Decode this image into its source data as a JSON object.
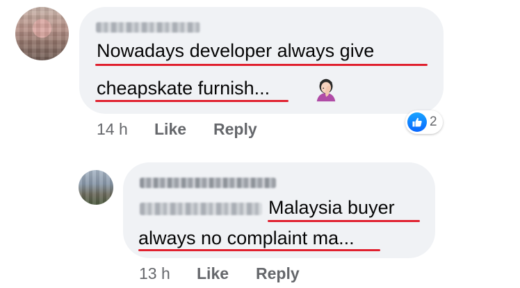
{
  "comment": {
    "text_line1": "Nowadays developer always give",
    "text_line2": "cheapskate furnish",
    "text_ellipsis": "...",
    "emoji_icon": "face-palm-emoji-icon",
    "time": "14 h",
    "like_label": "Like",
    "reply_label": "Reply",
    "reaction_icon": "like-reaction-icon",
    "reaction_count": "2"
  },
  "reply": {
    "text_line1": "Malaysia buyer",
    "text_line2": "always no complaint ma",
    "text_ellipsis": "...",
    "time": "13 h",
    "like_label": "Like",
    "reply_label": "Reply"
  },
  "colors": {
    "bubble": "#f0f2f5",
    "underline_annotation": "#e0202e",
    "like_blue": "#0866ff",
    "meta_gray": "#65676b"
  }
}
